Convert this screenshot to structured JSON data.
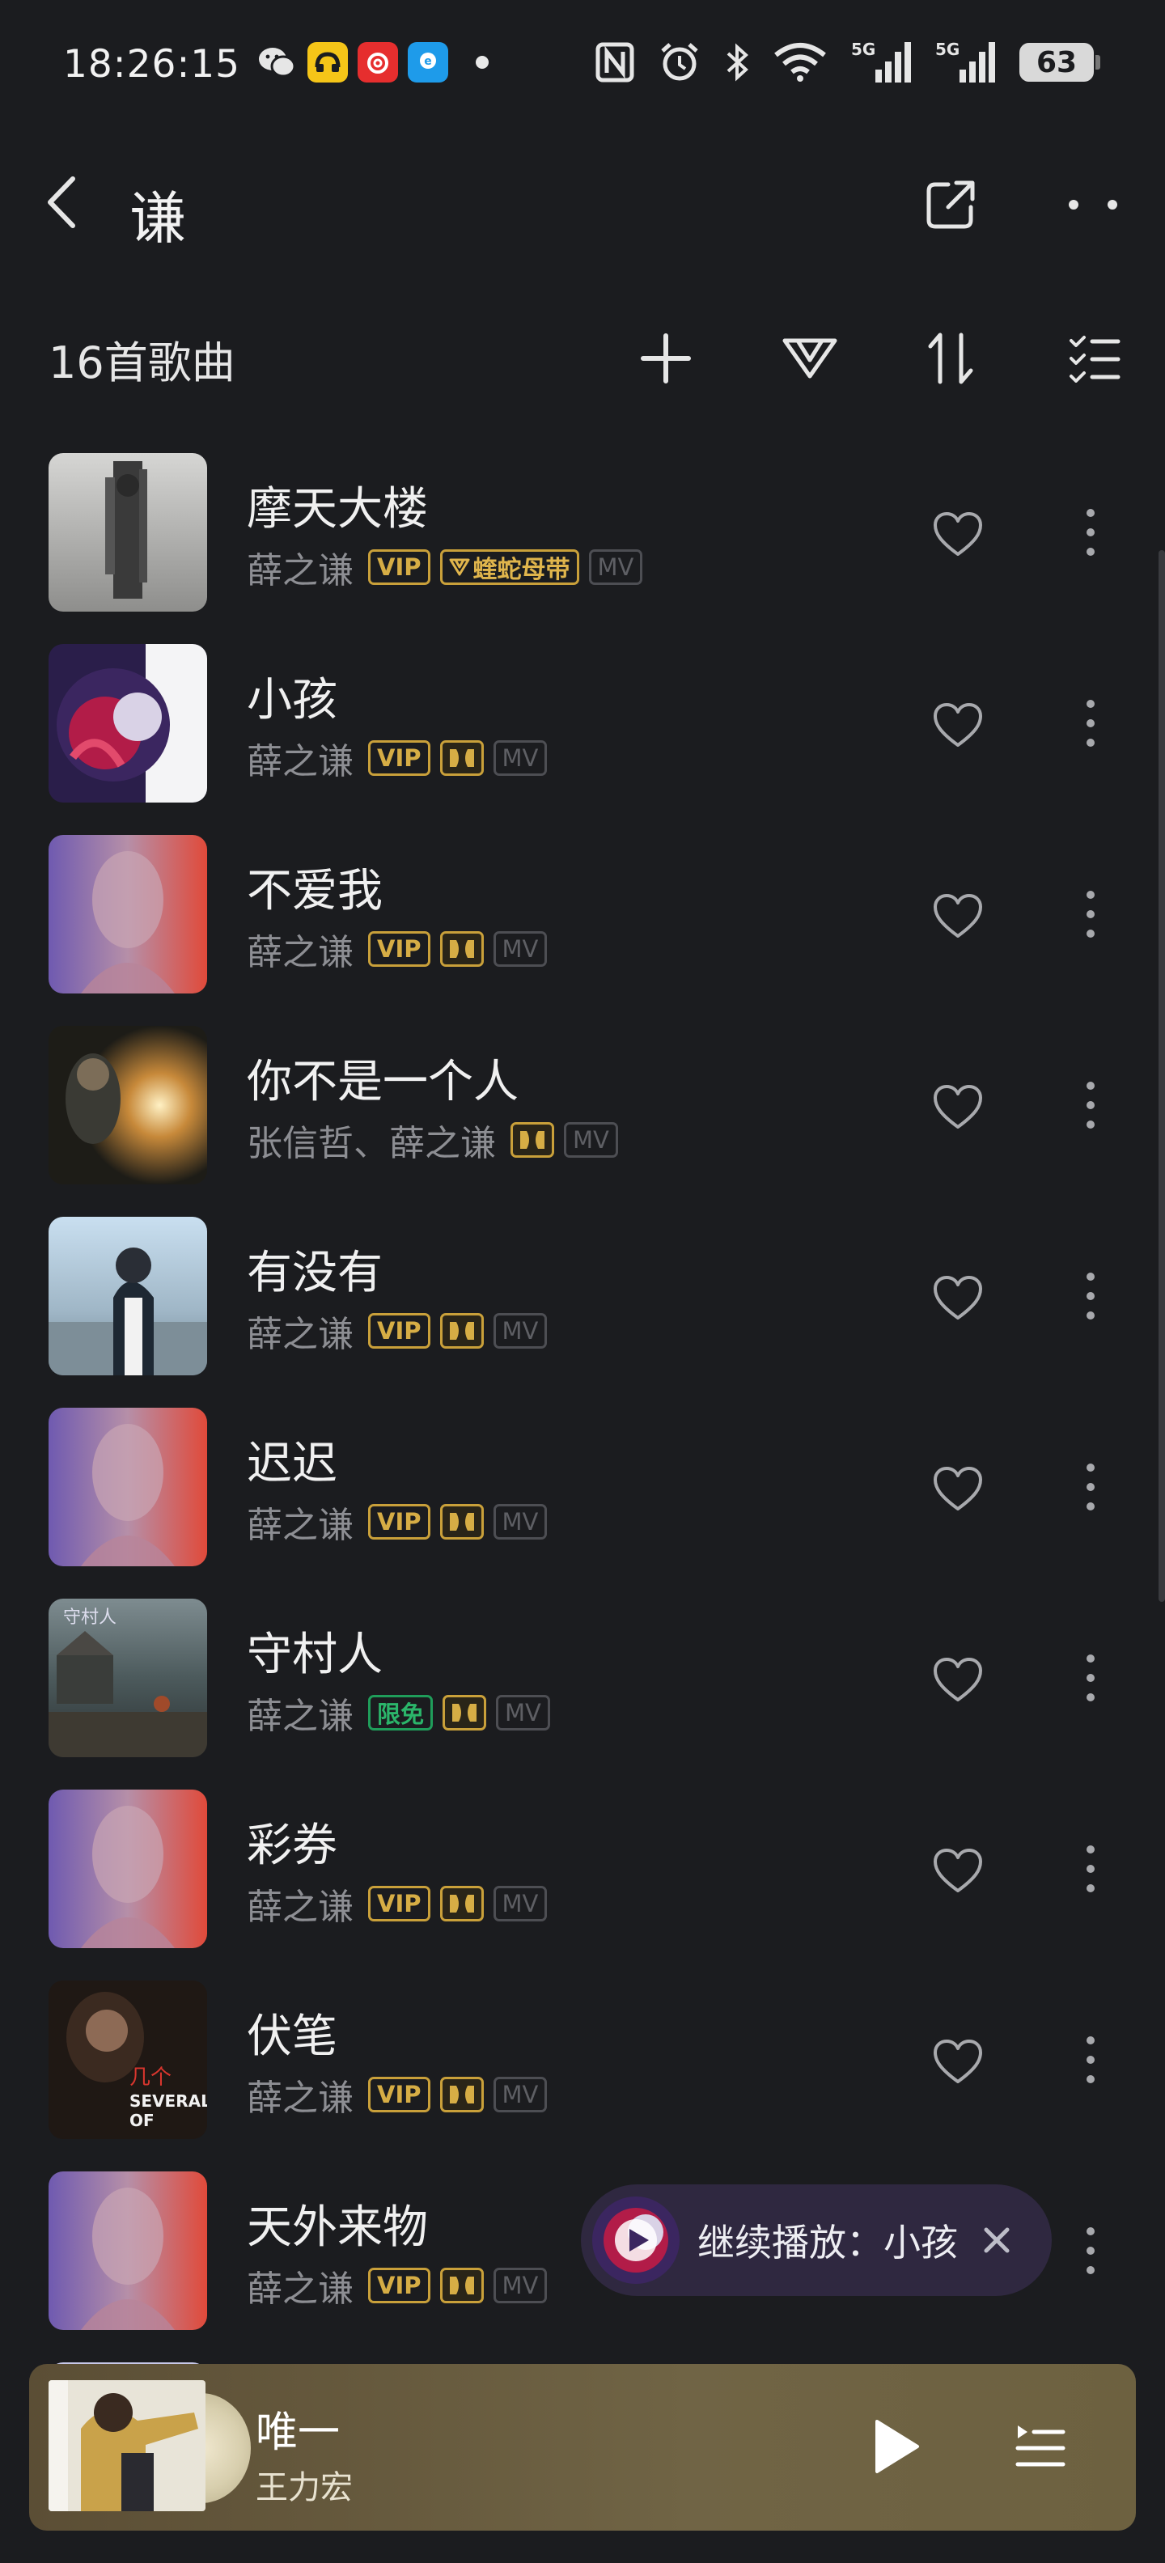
{
  "status_bar": {
    "time": "18:26:15",
    "battery": "63",
    "icons": [
      "wechat-icon",
      "app-icon-yellow",
      "netease-music-icon",
      "app-icon-blue",
      "nfc-icon",
      "alarm-icon",
      "bluetooth-icon",
      "wifi-icon",
      "signal-5g-icon",
      "signal-5g-icon",
      "battery-icon"
    ]
  },
  "header": {
    "title": "谦"
  },
  "toolbar": {
    "song_count": "16首歌曲"
  },
  "colors": {
    "background": "#1b1c1f",
    "gold_badge": "#c9a03a",
    "free_badge": "#1f9d5a"
  },
  "songs": [
    {
      "title": "摩天大楼",
      "artist": "薛之谦",
      "badges": [
        "VIP",
        "蝰蛇母带",
        "MV"
      ]
    },
    {
      "title": "小孩",
      "artist": "薛之谦",
      "badges": [
        "VIP",
        "dolby",
        "MV"
      ]
    },
    {
      "title": "不爱我",
      "artist": "薛之谦",
      "badges": [
        "VIP",
        "dolby",
        "MV"
      ]
    },
    {
      "title": "你不是一个人",
      "artist": "张信哲、薛之谦",
      "badges": [
        "dolby",
        "MV"
      ]
    },
    {
      "title": "有没有",
      "artist": "薛之谦",
      "badges": [
        "VIP",
        "dolby",
        "MV"
      ]
    },
    {
      "title": "迟迟",
      "artist": "薛之谦",
      "badges": [
        "VIP",
        "dolby",
        "MV"
      ]
    },
    {
      "title": "守村人",
      "artist": "薛之谦",
      "badges": [
        "限免",
        "dolby",
        "MV"
      ]
    },
    {
      "title": "彩券",
      "artist": "薛之谦",
      "badges": [
        "VIP",
        "dolby",
        "MV"
      ]
    },
    {
      "title": "伏笔",
      "artist": "薛之谦",
      "badges": [
        "VIP",
        "dolby",
        "MV"
      ]
    },
    {
      "title": "天外来物",
      "artist": "薛之谦",
      "badges": [
        "VIP",
        "dolby",
        "MV"
      ]
    }
  ],
  "cover_art_text": {
    "fubi": "几个",
    "fubi_sub": "SEVERAL OF"
  },
  "continue_pill": {
    "label": "继续播放：小孩"
  },
  "mini_player": {
    "title": "唯一",
    "artist": "王力宏"
  }
}
